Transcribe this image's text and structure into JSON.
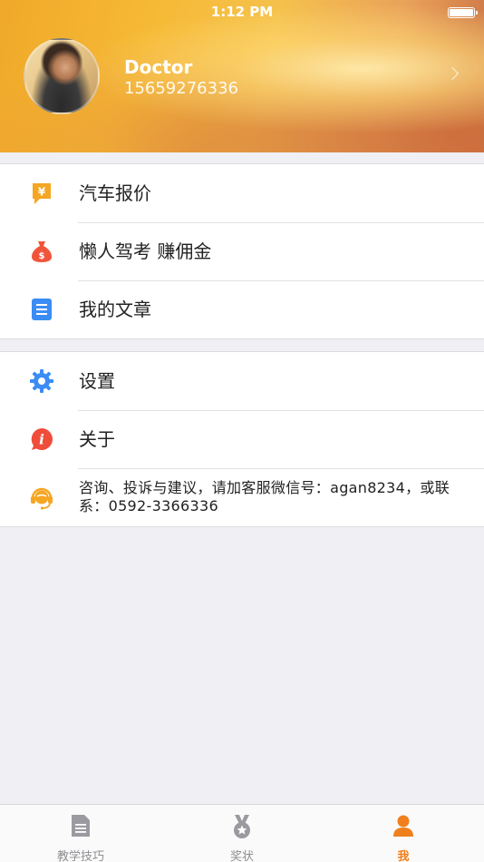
{
  "status_bar": {
    "time": "1:12 PM"
  },
  "profile": {
    "name": "Doctor",
    "phone": "15659276336"
  },
  "menu_group_1": [
    {
      "label": "汽车报价",
      "icon": "price-tag-icon",
      "color": "#f5a623"
    },
    {
      "label": "懒人驾考 赚佣金",
      "icon": "money-bag-icon",
      "color": "#f0553b"
    },
    {
      "label": "我的文章",
      "icon": "document-icon",
      "color": "#3b8cf5"
    }
  ],
  "menu_group_2": [
    {
      "label": "设置",
      "icon": "gear-icon",
      "color": "#3b8cf5"
    },
    {
      "label": "关于",
      "icon": "info-icon",
      "color": "#ef4d3a"
    },
    {
      "label": "咨询、投诉与建议，请加客服微信号：agan8234，或联系：0592-3366336",
      "icon": "customer-service-icon",
      "color": "#f5a623"
    }
  ],
  "tabbar": [
    {
      "label": "教学技巧",
      "icon": "document-icon",
      "active": false
    },
    {
      "label": "奖状",
      "icon": "medal-icon",
      "active": false
    },
    {
      "label": "我",
      "icon": "person-icon",
      "active": true
    }
  ],
  "colors": {
    "accent": "#f07f1d",
    "background": "#efeff4"
  }
}
